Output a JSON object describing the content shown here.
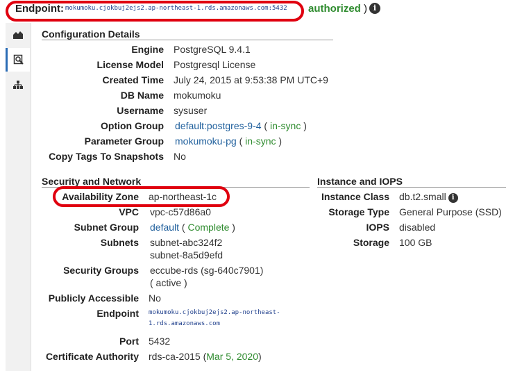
{
  "top": {
    "endpoint_label": "Endpoint:",
    "endpoint_value": "mokumoku.cjokbuj2ejs2.ap-northeast-1.rds.amazonaws.com:5432",
    "status_text": "authorized",
    "status_suffix": ")"
  },
  "tabs": [
    {
      "icon": "area-chart-icon"
    },
    {
      "icon": "magnifier-icon"
    },
    {
      "icon": "topology-icon"
    }
  ],
  "config": {
    "title": "Configuration Details",
    "rows": [
      {
        "label": "Engine",
        "value": "PostgreSQL 9.4.1"
      },
      {
        "label": "License Model",
        "value": "Postgresql License"
      },
      {
        "label": "Created Time",
        "value": "July 24, 2015 at 9:53:38 PM UTC+9"
      },
      {
        "label": "DB Name",
        "value": "mokumoku"
      },
      {
        "label": "Username",
        "value": "sysuser"
      },
      {
        "label": "Option Group",
        "link": "default:postgres-9-4",
        "status": "in-sync"
      },
      {
        "label": "Parameter Group",
        "link": "mokumoku-pg",
        "status": "in-sync"
      },
      {
        "label": "Copy Tags To Snapshots",
        "value": "No"
      }
    ]
  },
  "security": {
    "title": "Security and Network",
    "availability_zone_label": "Availability Zone",
    "availability_zone": "ap-northeast-1c",
    "vpc_label": "VPC",
    "vpc": "vpc-c57d86a0",
    "subnet_group_label": "Subnet Group",
    "subnet_group": "default",
    "subnet_group_status": "Complete",
    "subnets_label": "Subnets",
    "subnets": [
      "subnet-abc324f2",
      "subnet-8a5d9efd"
    ],
    "security_groups_label": "Security Groups",
    "security_group": "eccube-rds (sg-640c7901)",
    "security_group_status": "( active )",
    "public_label": "Publicly Accessible",
    "public": "No",
    "endpoint_label": "Endpoint",
    "endpoint_line1": "mokumoku.cjokbuj2ejs2.ap-northeast-",
    "endpoint_line2": "1.rds.amazonaws.com",
    "port_label": "Port",
    "port": "5432",
    "ca_label": "Certificate Authority",
    "ca": "rds-ca-2015",
    "ca_date": "Mar 5, 2020"
  },
  "instance": {
    "title": "Instance and IOPS",
    "rows": [
      {
        "label": "Instance Class",
        "value": "db.t2.small"
      },
      {
        "label": "Storage Type",
        "value": "General Purpose (SSD)"
      },
      {
        "label": "IOPS",
        "value": "disabled"
      },
      {
        "label": "Storage",
        "value": "100 GB"
      }
    ]
  },
  "colors": {
    "link": "#1f5f9c",
    "status_ok": "#2e8b2e",
    "highlight": "#e0000f",
    "tab_accent": "#2b6cb5"
  }
}
